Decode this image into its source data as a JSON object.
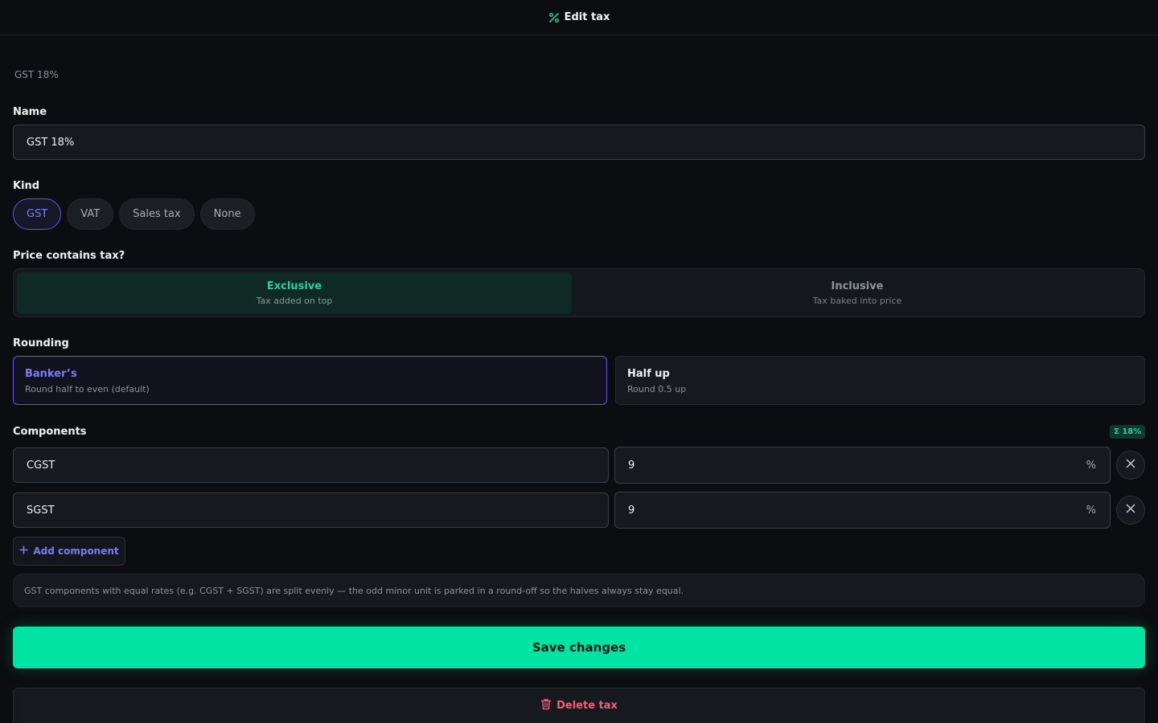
{
  "header": {
    "title": "Edit tax",
    "icon": "percent-icon"
  },
  "breadcrumb": "GST 18%",
  "name": {
    "label": "Name",
    "value": "GST 18%"
  },
  "kind": {
    "label": "Kind",
    "options": [
      "GST",
      "VAT",
      "Sales tax",
      "None"
    ],
    "selected": "GST"
  },
  "price_mode": {
    "label": "Price contains tax?",
    "options": [
      {
        "title": "Exclusive",
        "subtitle": "Tax added on top"
      },
      {
        "title": "Inclusive",
        "subtitle": "Tax baked into price"
      }
    ],
    "selected": "Exclusive"
  },
  "rounding": {
    "label": "Rounding",
    "options": [
      {
        "title": "Banker’s",
        "subtitle": "Round half to even (default)"
      },
      {
        "title": "Half up",
        "subtitle": "Round 0.5 up"
      }
    ],
    "selected": "Banker’s"
  },
  "components": {
    "label": "Components",
    "total_badge": "Σ 18%",
    "unit": "%",
    "rows": [
      {
        "name": "CGST",
        "rate": "9"
      },
      {
        "name": "SGST",
        "rate": "9"
      }
    ],
    "add_label": "Add component"
  },
  "note": "GST components with equal rates (e.g. CGST + SGST) are split evenly — the odd minor unit is parked in a round-off so the halves always stay equal.",
  "actions": {
    "save_label": "Save changes",
    "delete_label": "Delete tax"
  },
  "colors": {
    "accent_green": "#00e3a2",
    "accent_purple": "#7f7bf5",
    "danger": "#f0607a",
    "background": "#0b0d10"
  }
}
